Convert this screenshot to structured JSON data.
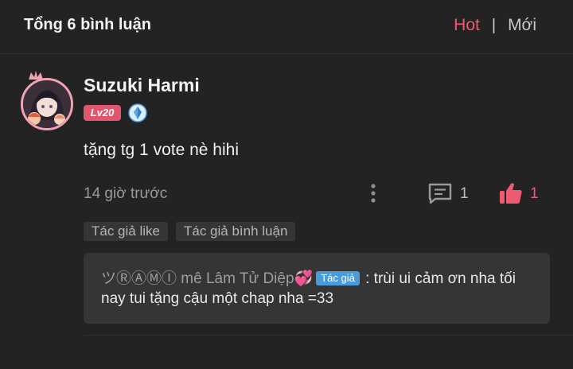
{
  "header": {
    "comment_count_label": "Tổng 6 bình luận",
    "sort_hot": "Hot",
    "sort_separator": "|",
    "sort_new": "Mới"
  },
  "comment": {
    "username": "Suzuki Harmi",
    "level_badge": "Lv20",
    "medal_icon": "blue-diamond-medal",
    "text": "tặng tg 1 vote nè hihi",
    "time": "14 giờ trước",
    "reply_count": "1",
    "like_count": "1",
    "tags": [
      "Tác giả like",
      "Tác giả bình luận"
    ],
    "reply": {
      "author_name": "ツⓇⒶⓂⒾ mê Lâm Tử Diệp",
      "author_heart": "💞",
      "author_badge": "Tác giả",
      "text": ": trùi ui cảm ơn nha tối nay tui tặng cậu một chap nha =33"
    }
  },
  "colors": {
    "background": "#232323",
    "accent": "#ee5a73",
    "author_badge": "#4a9bd9"
  }
}
